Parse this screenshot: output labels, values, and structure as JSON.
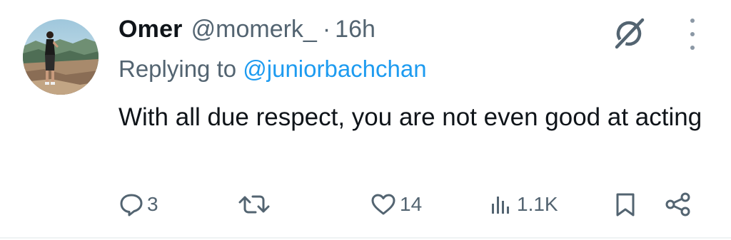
{
  "tweet": {
    "author_name": "Omer",
    "author_handle": "@momerk_",
    "separator": "·",
    "time": "16h",
    "replying_prefix": "Replying to ",
    "replying_to": "@juniorbachchan",
    "text": "With all due respect, you are not even good at acting"
  },
  "actions": {
    "reply_count": "3",
    "retweet_count": "",
    "like_count": "14",
    "views_count": "1.1K"
  },
  "icons": {
    "grok": "grok-icon",
    "more": "more-vertical-icon",
    "reply": "reply-icon",
    "retweet": "retweet-icon",
    "like": "heart-icon",
    "views": "views-icon",
    "bookmark": "bookmark-icon",
    "share": "share-icon"
  },
  "colors": {
    "text_primary": "#0f1419",
    "text_secondary": "#536471",
    "accent": "#1d9bf0"
  }
}
